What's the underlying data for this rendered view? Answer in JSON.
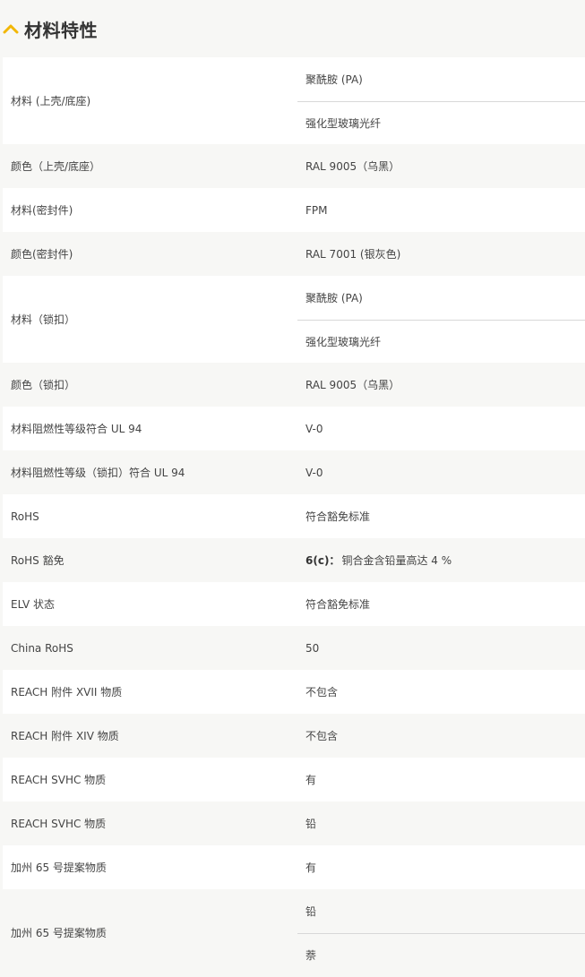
{
  "section": {
    "title": "材料特性",
    "accent_color": "#f2b705",
    "icon": "chevron-up-icon"
  },
  "rows": [
    {
      "label": "材料 (上壳/底座)",
      "values": [
        "聚酰胺 (PA)",
        "强化型玻璃光纤"
      ]
    },
    {
      "label": "颜色（上壳/底座）",
      "values": [
        "RAL 9005（乌黑）"
      ]
    },
    {
      "label": "材料(密封件)",
      "values": [
        "FPM"
      ]
    },
    {
      "label": "颜色(密封件)",
      "values": [
        "RAL 7001 (银灰色)"
      ]
    },
    {
      "label": "材料（锁扣）",
      "values": [
        "聚酰胺 (PA)",
        "强化型玻璃光纤"
      ]
    },
    {
      "label": "颜色（锁扣）",
      "values": [
        "RAL 9005（乌黑）"
      ]
    },
    {
      "label": "材料阻燃性等级符合 UL 94",
      "values": [
        "V-0"
      ]
    },
    {
      "label": "材料阻燃性等级（锁扣）符合 UL 94",
      "values": [
        "V-0"
      ]
    },
    {
      "label": "RoHS",
      "values": [
        "符合豁免标准"
      ]
    },
    {
      "label": "RoHS 豁免",
      "values": [
        "6(c)：铜合金含铅量高达 4 %"
      ],
      "bold_prefix": "6(c)："
    },
    {
      "label": "ELV 状态",
      "values": [
        "符合豁免标准"
      ]
    },
    {
      "label": "China RoHS",
      "values": [
        "50"
      ]
    },
    {
      "label": "REACH 附件 XVII 物质",
      "values": [
        "不包含"
      ]
    },
    {
      "label": "REACH 附件 XIV 物质",
      "values": [
        "不包含"
      ]
    },
    {
      "label": "REACH SVHC 物质",
      "values": [
        "有"
      ]
    },
    {
      "label": "REACH SVHC 物质",
      "values": [
        "铅"
      ]
    },
    {
      "label": "加州 65 号提案物质",
      "values": [
        "有"
      ]
    },
    {
      "label": "加州 65 号提案物质",
      "values": [
        "铅",
        "萘"
      ]
    }
  ]
}
